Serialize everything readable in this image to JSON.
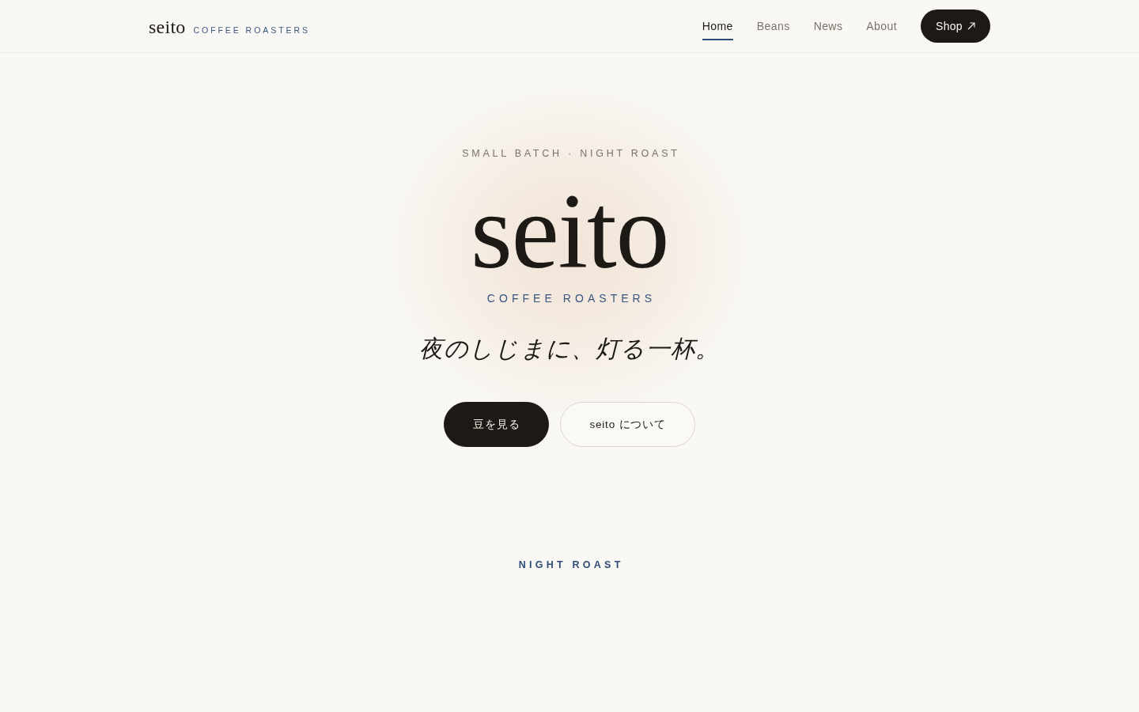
{
  "header": {
    "logo": {
      "wordmark": "seito",
      "tagline": "COFFEE ROASTERS"
    },
    "nav": [
      {
        "label": "Home",
        "selected": true
      },
      {
        "label": "Beans",
        "selected": false
      },
      {
        "label": "News",
        "selected": false
      },
      {
        "label": "About",
        "selected": false
      }
    ],
    "shop_button": {
      "label": "Shop"
    }
  },
  "hero": {
    "eyebrow": "SMALL BATCH · NIGHT ROAST",
    "title": "seito",
    "subtitle": "COFFEE ROASTERS",
    "tagline": "夜のしじまに、灯る一杯。",
    "buttons": [
      {
        "label": "豆を見る",
        "kind": "primary"
      },
      {
        "label": "seito について",
        "kind": "secondary"
      }
    ]
  },
  "section": {
    "eyebrow": "NIGHT ROAST"
  }
}
